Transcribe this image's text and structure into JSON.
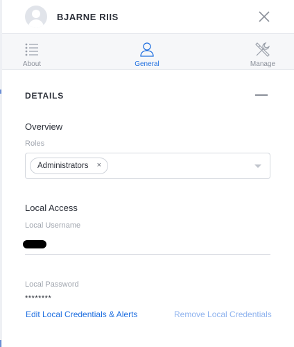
{
  "header": {
    "user_name": "BJARNE RIIS"
  },
  "tabs": [
    {
      "label": "About",
      "icon": "list-icon",
      "active": false
    },
    {
      "label": "General",
      "icon": "user-icon",
      "active": true
    },
    {
      "label": "Manage",
      "icon": "tools-icon",
      "active": false
    }
  ],
  "details": {
    "heading": "DETAILS",
    "overview": {
      "title": "Overview",
      "roles_label": "Roles",
      "roles": [
        "Administrators"
      ],
      "chip_remove": "×"
    },
    "local_access": {
      "title": "Local Access",
      "username_label": "Local Username",
      "password_label": "Local Password",
      "password_value": "********"
    },
    "links": {
      "edit": "Edit Local Credentials & Alerts",
      "remove": "Remove Local Credentials"
    }
  },
  "colors": {
    "accent": "#1f6fe0",
    "accent_disabled": "#8fb3ee",
    "muted_text": "#a0a5ae",
    "tab_bar_bg": "#f6f7f9"
  }
}
